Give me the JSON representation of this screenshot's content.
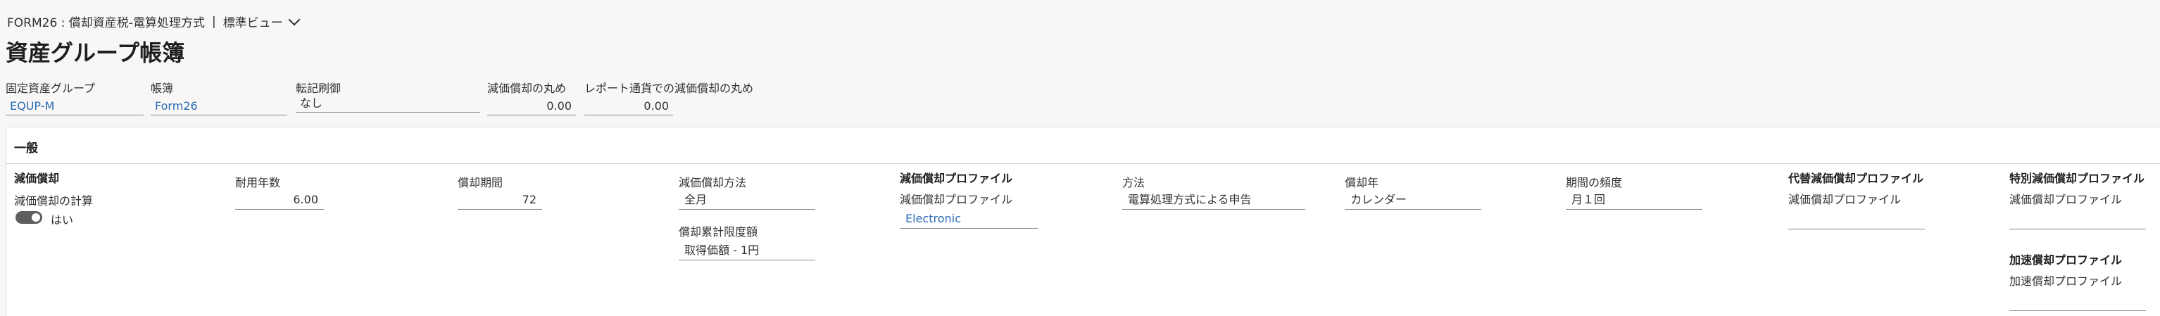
{
  "breadcrumb": {
    "form": "FORM26 : 償却資産税-電算処理方式",
    "separator": "|",
    "view": "標準ビュー"
  },
  "page_title": "資産グループ帳簿",
  "header_fields": {
    "asset_group": {
      "label": "固定資産グループ",
      "value": "EQUP-M"
    },
    "book": {
      "label": "帳簿",
      "value": "Form26"
    },
    "posting_profile": {
      "label": "転記刷御",
      "value": "なし"
    },
    "depreciation_rounding": {
      "label": "減価償却の丸め",
      "value": "0.00"
    },
    "report_currency_rounding": {
      "label": "レポート通貨での減価償却の丸め",
      "value": "0.00"
    }
  },
  "section": {
    "title": "一般"
  },
  "depreciation": {
    "group_title": "減価償却",
    "calc_label": "減価償却の計算",
    "calc_toggle_label": "はい",
    "calc_toggle_on": true
  },
  "service_life": {
    "label": "耐用年数",
    "value": "6.00"
  },
  "depreciation_periods": {
    "label": "償却期間",
    "value": "72"
  },
  "depreciation_convention": {
    "label": "減価償却方法",
    "value": "全月"
  },
  "accumulated_limit": {
    "label": "償却累計限度額",
    "value": "取得価額 - 1円"
  },
  "depreciation_profile": {
    "group_title": "減価償却プロファイル",
    "label": "減価償却プロファイル",
    "value": "Electronic"
  },
  "method": {
    "label": "方法",
    "value": "電算処理方式による申告"
  },
  "depreciation_year": {
    "label": "償却年",
    "value": "カレンダー"
  },
  "period_frequency": {
    "label": "期間の頻度",
    "value": "月１回"
  },
  "alt_profile": {
    "group_title": "代替減価償却プロファイル",
    "label": "減価償却プロファイル",
    "value": ""
  },
  "special_profile": {
    "group_title": "特別減価償却プロファイル",
    "label": "減価償却プロファイル",
    "value": ""
  },
  "accelerated_profile": {
    "group_title": "加速償却プロファイル",
    "label": "加速償却プロファイル",
    "value": ""
  },
  "colors": {
    "link": "#2b6bb5",
    "toggle": "#605e5c",
    "background": "#f8f7f6"
  },
  "icons": {
    "view_dropdown": "chevron-down-icon"
  }
}
